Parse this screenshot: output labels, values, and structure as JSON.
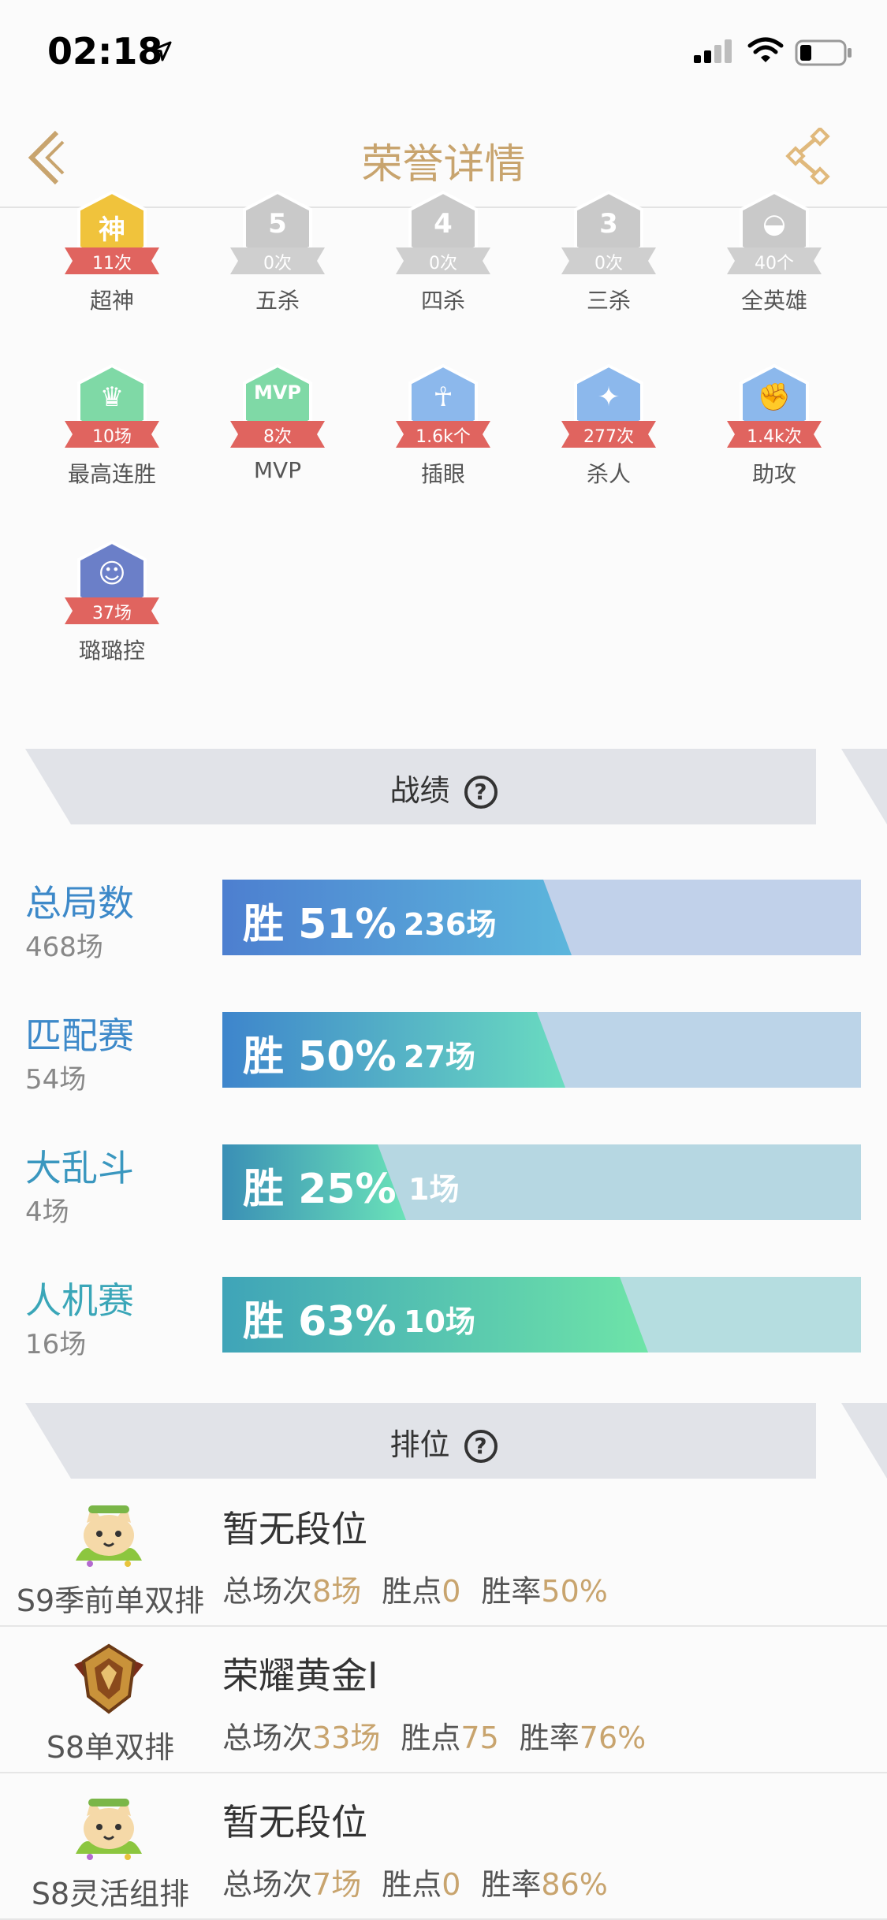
{
  "status": {
    "time": "02:18"
  },
  "nav": {
    "title": "荣誉详情"
  },
  "badges": [
    {
      "label": "超神",
      "count": "11次",
      "glyph": "神",
      "color": "#f0c33c",
      "ribbon": "#e0645f"
    },
    {
      "label": "五杀",
      "count": "0次",
      "glyph": "5",
      "color": "#c9c9c9",
      "ribbon": "#cfcfcf"
    },
    {
      "label": "四杀",
      "count": "0次",
      "glyph": "4",
      "color": "#c9c9c9",
      "ribbon": "#cfcfcf"
    },
    {
      "label": "三杀",
      "count": "0次",
      "glyph": "3",
      "color": "#c9c9c9",
      "ribbon": "#cfcfcf"
    },
    {
      "label": "全英雄",
      "count": "40个",
      "glyph": "◒",
      "color": "#c9c9c9",
      "ribbon": "#cfcfcf"
    },
    {
      "label": "最高连胜",
      "count": "10场",
      "glyph": "♛",
      "color": "#7fd9a6",
      "ribbon": "#e0645f"
    },
    {
      "label": "MVP",
      "count": "8次",
      "glyph": "MVP",
      "color": "#7fd9a6",
      "ribbon": "#e0645f"
    },
    {
      "label": "插眼",
      "count": "1.6k个",
      "glyph": "☥",
      "color": "#8cb8ec",
      "ribbon": "#e0645f"
    },
    {
      "label": "杀人",
      "count": "277次",
      "glyph": "✦",
      "color": "#8cb8ec",
      "ribbon": "#e0645f"
    },
    {
      "label": "助攻",
      "count": "1.4k次",
      "glyph": "✊",
      "color": "#8cb8ec",
      "ribbon": "#e0645f"
    },
    {
      "label": "璐璐控",
      "count": "37场",
      "glyph": "☺",
      "color": "#6b7fc8",
      "ribbon": "#e0645f"
    }
  ],
  "record": {
    "title": "战绩",
    "help": "?",
    "rows": [
      {
        "name": "总局数",
        "count": "468场",
        "win": "胜 51%",
        "games": "236场",
        "rate": 0.51,
        "color": "#3d89c9",
        "bar_bg": "#c1d1ea",
        "fill_from": "#4d7fd0",
        "fill_to": "#5cb6dc"
      },
      {
        "name": "匹配赛",
        "count": "54场",
        "win": "胜 50%",
        "games": "27场",
        "rate": 0.5,
        "color": "#3d89c9",
        "bar_bg": "#bcd4e8",
        "fill_from": "#3e85cc",
        "fill_to": "#6adcc0"
      },
      {
        "name": "大乱斗",
        "count": "4场",
        "win": "胜 25%",
        "games": "1场",
        "rate": 0.25,
        "color": "#3a97bf",
        "bar_bg": "#b6d7e2",
        "fill_from": "#3a8fb6",
        "fill_to": "#6ae2b8"
      },
      {
        "name": "人机赛",
        "count": "16场",
        "win": "胜 63%",
        "games": "10场",
        "rate": 0.63,
        "color": "#3aa6b8",
        "bar_bg": "#b5dde0",
        "fill_from": "#3fa4b8",
        "fill_to": "#6ee4a8"
      }
    ]
  },
  "ranked": {
    "title": "排位",
    "help": "?",
    "rows": [
      {
        "queue": "S9季前单双排",
        "tier": "暂无段位",
        "total_label": "总场次",
        "total": "8场",
        "points_label": "胜点",
        "points": "0",
        "rate_label": "胜率",
        "rate": "50%",
        "icon": "cat"
      },
      {
        "queue": "S8单双排",
        "tier": "荣耀黄金I",
        "total_label": "总场次",
        "total": "33场",
        "points_label": "胜点",
        "points": "75",
        "rate_label": "胜率",
        "rate": "76%",
        "icon": "gold"
      },
      {
        "queue": "S8灵活组排",
        "tier": "暂无段位",
        "total_label": "总场次",
        "total": "7场",
        "points_label": "胜点",
        "points": "0",
        "rate_label": "胜率",
        "rate": "86%",
        "icon": "cat"
      }
    ]
  }
}
